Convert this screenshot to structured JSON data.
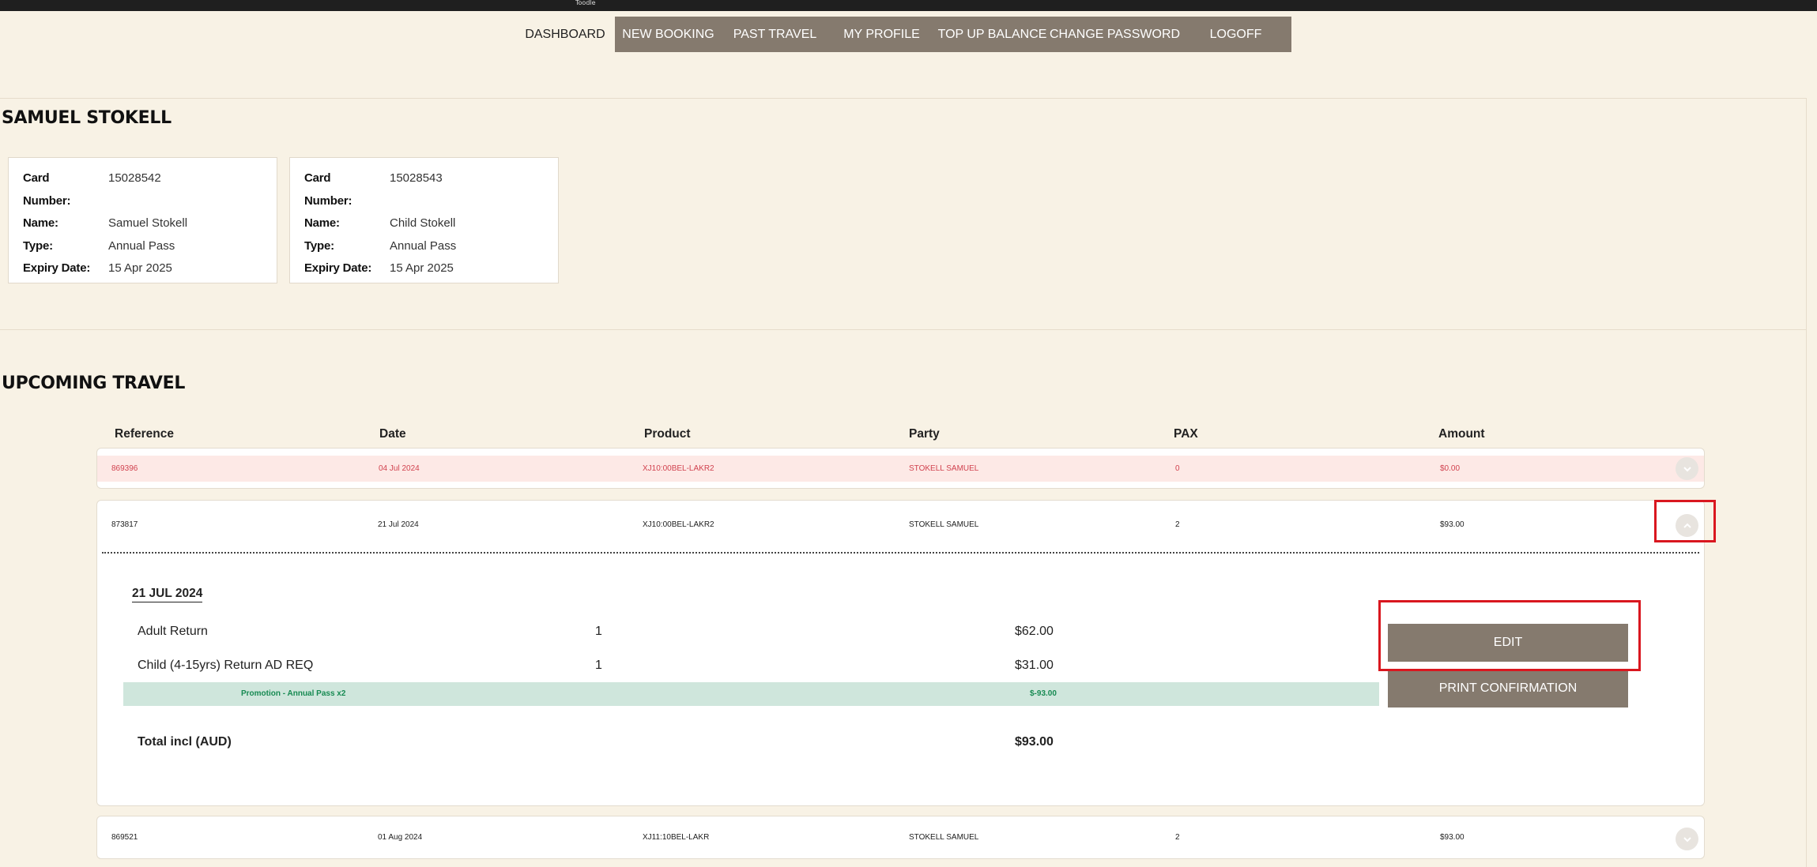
{
  "topbar": {
    "title": "Toodle"
  },
  "nav": {
    "dashboard": "DASHBOARD",
    "new_booking": "NEW BOOKING",
    "past_travel": "PAST TRAVEL",
    "my_profile": "MY PROFILE",
    "top_up": "TOP UP BALANCE",
    "change_password": "CHANGE PASSWORD",
    "logoff": "LOGOFF"
  },
  "user": {
    "name": "SAMUEL STOKELL"
  },
  "card_labels": {
    "card_number_1": "Card",
    "card_number_2": "Number:",
    "name": "Name:",
    "type": "Type:",
    "expiry": "Expiry Date:"
  },
  "cards": [
    {
      "number": "15028542",
      "name": "Samuel Stokell",
      "type": "Annual Pass",
      "expiry": "15 Apr 2025"
    },
    {
      "number": "15028543",
      "name": "Child Stokell",
      "type": "Annual Pass",
      "expiry": "15 Apr 2025"
    }
  ],
  "upcoming": {
    "heading": "UPCOMING TRAVEL",
    "columns": [
      "Reference",
      "Date",
      "Product",
      "Party",
      "PAX",
      "Amount"
    ],
    "rows": [
      {
        "reference": "869396",
        "date": "04 Jul 2024",
        "product": "XJ10:00BEL-LAKR2",
        "party": "STOKELL SAMUEL",
        "pax": "0",
        "amount": "$0.00",
        "status": "cancelled"
      },
      {
        "reference": "873817",
        "date": "21 Jul 2024",
        "product": "XJ10:00BEL-LAKR2",
        "party": "STOKELL SAMUEL",
        "pax": "2",
        "amount": "$93.00",
        "status": "expanded"
      },
      {
        "reference": "869521",
        "date": "01 Aug 2024",
        "product": "XJ11:10BEL-LAKR",
        "party": "STOKELL SAMUEL",
        "pax": "2",
        "amount": "$93.00",
        "status": "collapsed"
      }
    ]
  },
  "detail": {
    "date": "21 JUL 2024",
    "items": [
      {
        "label": "Adult Return",
        "qty": "1",
        "price": "$62.00"
      },
      {
        "label": "Child (4-15yrs) Return AD REQ",
        "qty": "1",
        "price": "$31.00"
      }
    ],
    "promo": {
      "label": "Promotion - Annual Pass x2",
      "amount": "$-93.00"
    },
    "total_label": "Total incl (AUD)",
    "total_value": "$93.00",
    "edit_button": "EDIT",
    "print_button": "PRINT CONFIRMATION"
  },
  "colors": {
    "background": "#f8f2e5",
    "nav_bg": "#857a6e",
    "cancelled_text": "#d1424f",
    "cancelled_bg": "#fde9e6",
    "promo_bg": "#cfe6dc",
    "promo_text": "#178a52",
    "highlight": "#d9171f"
  }
}
